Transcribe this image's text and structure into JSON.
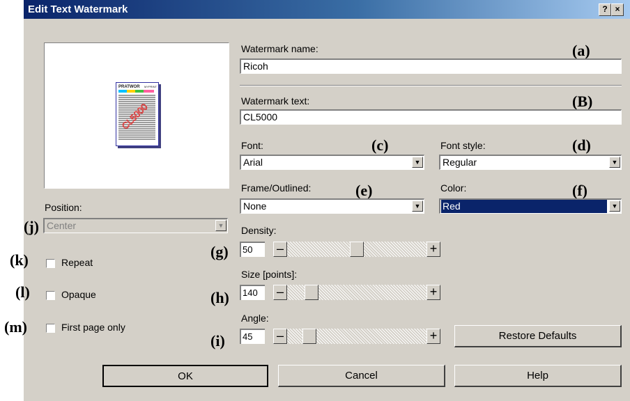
{
  "window": {
    "title": "Edit Text Watermark",
    "help_btn": "?",
    "close_btn": "×"
  },
  "preview": {
    "doc_header": "PRATWOR",
    "doc_header_right": "MYPRINT",
    "doc_watermark": "CL5000"
  },
  "watermark_name": {
    "label": "Watermark name:",
    "value": "Ricoh",
    "annot": "(a)"
  },
  "watermark_text": {
    "label": "Watermark text:",
    "value": "CL5000",
    "annot": "(B)"
  },
  "font": {
    "label": "Font:",
    "value": "Arial",
    "annot": "(c)"
  },
  "font_style": {
    "label": "Font style:",
    "value": "Regular",
    "annot": "(d)"
  },
  "frame": {
    "label": "Frame/Outlined:",
    "value": "None",
    "annot": "(e)"
  },
  "color": {
    "label": "Color:",
    "value": "Red",
    "annot": "(f)"
  },
  "position": {
    "label": "Position:",
    "value": "Center",
    "annot": "(j)"
  },
  "options": [
    {
      "label": "Repeat",
      "annot": "(k)",
      "checked": false
    },
    {
      "label": "Opaque",
      "annot": "(l)",
      "checked": false
    },
    {
      "label": "First page only",
      "annot": "(m)",
      "checked": false
    }
  ],
  "density": {
    "label": "Density:",
    "value": "50",
    "level": 0.5,
    "annot": "(g)"
  },
  "size": {
    "label": "Size [points]:",
    "value": "140",
    "level": 0.14,
    "annot": "(h)"
  },
  "angle": {
    "label": "Angle:",
    "value": "45",
    "level": 0.12,
    "annot": "(i)"
  },
  "spin_minus": "–",
  "spin_plus": "+",
  "buttons": {
    "restore": "Restore Defaults",
    "ok": "OK",
    "cancel": "Cancel",
    "help": "Help"
  },
  "colors": {
    "titlebar": "#0a246a",
    "dialog": "#d4d0c8",
    "selection": "#0a246a"
  }
}
